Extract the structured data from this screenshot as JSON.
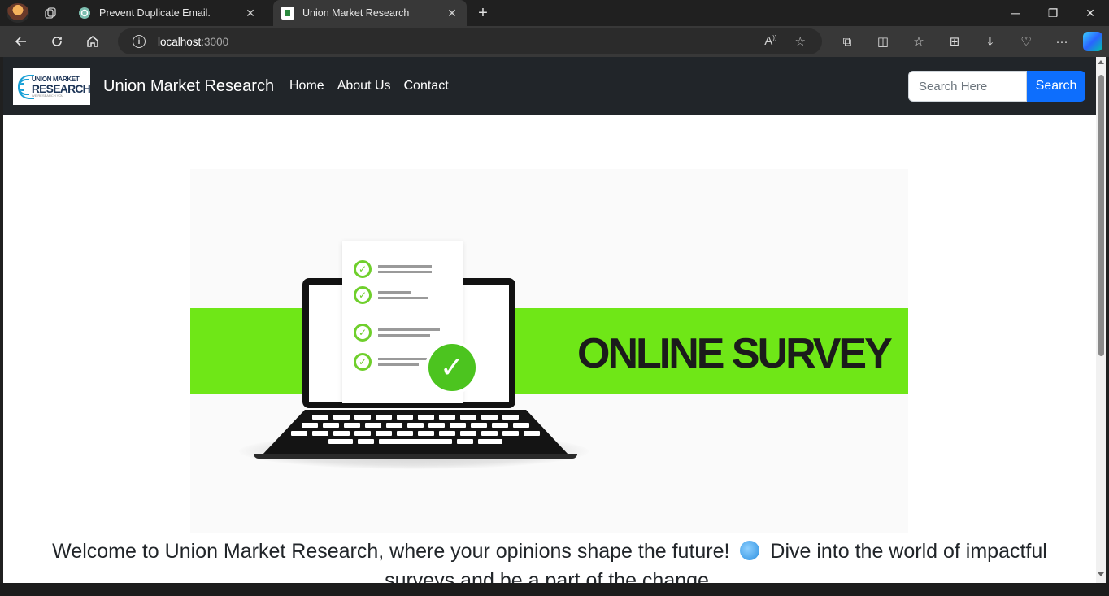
{
  "browser": {
    "tabs": [
      {
        "title": "Prevent Duplicate Email.",
        "active": false,
        "favicon": "chatgpt-icon"
      },
      {
        "title": "Union Market Research",
        "active": true,
        "favicon": "site-logo-icon"
      }
    ],
    "url_host": "localhost",
    "url_port": ":3000"
  },
  "site": {
    "logo": {
      "line1": "UNION MARKET",
      "line2": "RESEARCH",
      "line3": "WE RESEARCH YOU"
    },
    "brand": "Union Market Research",
    "nav": [
      {
        "label": "Home"
      },
      {
        "label": "About Us"
      },
      {
        "label": "Contact"
      }
    ],
    "search": {
      "placeholder": "Search Here",
      "button": "Search"
    },
    "hero": {
      "banner_text": "ONLINE SURVEY"
    },
    "welcome_part1": "Welcome to Union Market Research, where your opinions shape the future!",
    "welcome_part2": "Dive into the world of impactful surveys and be a part of the change."
  },
  "colors": {
    "navbar": "#212529",
    "search_button": "#0d6efd",
    "banner_green": "#6fe717"
  }
}
